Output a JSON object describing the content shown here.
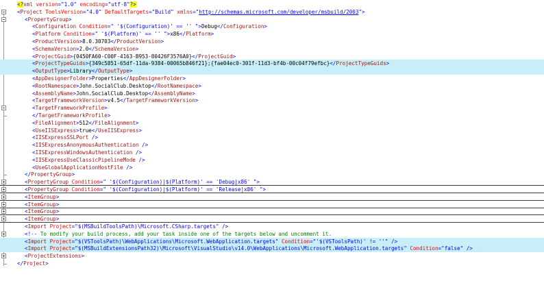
{
  "editor": {
    "lines": [
      {
        "indent": 0,
        "fold": "none",
        "parts": [
          [
            "pi",
            "<?"
          ],
          [
            "tag",
            "xml "
          ],
          [
            "attr",
            "version"
          ],
          [
            "bracket",
            "=\""
          ],
          [
            "val",
            "1.0"
          ],
          [
            "bracket",
            "\" "
          ],
          [
            "attr",
            "encoding"
          ],
          [
            "bracket",
            "=\""
          ],
          [
            "val",
            "utf-8"
          ],
          [
            "bracket",
            "\""
          ],
          [
            "pi",
            "?>"
          ]
        ]
      },
      {
        "indent": 0,
        "fold": "open",
        "parts": [
          [
            "bracket",
            "<"
          ],
          [
            "tag",
            "Project "
          ],
          [
            "attr",
            "ToolsVersion"
          ],
          [
            "bracket",
            "=\""
          ],
          [
            "val",
            "4.0"
          ],
          [
            "bracket",
            "\" "
          ],
          [
            "attr",
            "DefaultTargets"
          ],
          [
            "bracket",
            "=\""
          ],
          [
            "val",
            "Build"
          ],
          [
            "bracket",
            "\" "
          ],
          [
            "attr",
            "xmlns"
          ],
          [
            "bracket",
            "=\""
          ],
          [
            "link",
            "http://schemas.microsoft.com/developer/msbuild/2003"
          ],
          [
            "bracket",
            "\">"
          ]
        ]
      },
      {
        "indent": 1,
        "fold": "open",
        "parts": [
          [
            "bracket",
            "<"
          ],
          [
            "tag",
            "PropertyGroup"
          ],
          [
            "bracket",
            ">"
          ]
        ]
      },
      {
        "indent": 2,
        "fold": "none",
        "parts": [
          [
            "bracket",
            "<"
          ],
          [
            "tag",
            "Configuration "
          ],
          [
            "attr",
            "Condition"
          ],
          [
            "bracket",
            "=\""
          ],
          [
            "val",
            " '$(Configuration)' == '' "
          ],
          [
            "bracket",
            "\">"
          ],
          [
            "text",
            "Debug"
          ],
          [
            "bracket",
            "</"
          ],
          [
            "tag",
            "Configuration"
          ],
          [
            "bracket",
            ">"
          ]
        ]
      },
      {
        "indent": 2,
        "fold": "none",
        "parts": [
          [
            "bracket",
            "<"
          ],
          [
            "tag",
            "Platform "
          ],
          [
            "attr",
            "Condition"
          ],
          [
            "bracket",
            "=\""
          ],
          [
            "val",
            " '$(Platform)' == '' "
          ],
          [
            "bracket",
            "\">"
          ],
          [
            "text",
            "x86"
          ],
          [
            "bracket",
            "</"
          ],
          [
            "tag",
            "Platform"
          ],
          [
            "bracket",
            ">"
          ]
        ]
      },
      {
        "indent": 2,
        "fold": "none",
        "parts": [
          [
            "bracket",
            "<"
          ],
          [
            "tag",
            "ProductVersion"
          ],
          [
            "bracket",
            ">"
          ],
          [
            "text",
            "8.0.30703"
          ],
          [
            "bracket",
            "</"
          ],
          [
            "tag",
            "ProductVersion"
          ],
          [
            "bracket",
            ">"
          ]
        ]
      },
      {
        "indent": 2,
        "fold": "none",
        "parts": [
          [
            "bracket",
            "<"
          ],
          [
            "tag",
            "SchemaVersion"
          ],
          [
            "bracket",
            ">"
          ],
          [
            "text",
            "2.0"
          ],
          [
            "bracket",
            "</"
          ],
          [
            "tag",
            "SchemaVersion"
          ],
          [
            "bracket",
            ">"
          ]
        ]
      },
      {
        "indent": 2,
        "fold": "none",
        "parts": [
          [
            "bracket",
            "<"
          ],
          [
            "tag",
            "ProjectGuid"
          ],
          [
            "bracket",
            ">"
          ],
          [
            "text",
            "{0450FA60-C00F-4163-B953-80426F3576A0}"
          ],
          [
            "bracket",
            "</"
          ],
          [
            "tag",
            "ProjectGuid"
          ],
          [
            "bracket",
            ">"
          ]
        ]
      },
      {
        "indent": 2,
        "fold": "none",
        "hl": true,
        "parts": [
          [
            "bracket",
            "<"
          ],
          [
            "tag",
            "ProjectTypeGuids"
          ],
          [
            "bracket",
            ">"
          ],
          [
            "text",
            "{349c5851-65df-11da-9384-00065b846f21};{fae04ec0-301f-11d3-bf4b-00c04f79efbc}"
          ],
          [
            "bracket",
            "</"
          ],
          [
            "tag",
            "ProjectTypeGuids"
          ],
          [
            "bracket",
            ">"
          ]
        ]
      },
      {
        "indent": 2,
        "fold": "none",
        "hl": true,
        "parts": [
          [
            "bracket",
            "<"
          ],
          [
            "tag",
            "OutputType"
          ],
          [
            "bracket",
            ">"
          ],
          [
            "text",
            "Library"
          ],
          [
            "bracket",
            "</"
          ],
          [
            "tag",
            "OutputType"
          ],
          [
            "bracket",
            ">"
          ]
        ]
      },
      {
        "indent": 2,
        "fold": "none",
        "parts": [
          [
            "bracket",
            "<"
          ],
          [
            "tag",
            "AppDesignerFolder"
          ],
          [
            "bracket",
            ">"
          ],
          [
            "text",
            "Properties"
          ],
          [
            "bracket",
            "</"
          ],
          [
            "tag",
            "AppDesignerFolder"
          ],
          [
            "bracket",
            ">"
          ]
        ]
      },
      {
        "indent": 2,
        "fold": "none",
        "parts": [
          [
            "bracket",
            "<"
          ],
          [
            "tag",
            "RootNamespace"
          ],
          [
            "bracket",
            ">"
          ],
          [
            "text",
            "John.SocialClub.Desktop"
          ],
          [
            "bracket",
            "</"
          ],
          [
            "tag",
            "RootNamespace"
          ],
          [
            "bracket",
            ">"
          ]
        ]
      },
      {
        "indent": 2,
        "fold": "none",
        "parts": [
          [
            "bracket",
            "<"
          ],
          [
            "tag",
            "AssemblyName"
          ],
          [
            "bracket",
            ">"
          ],
          [
            "text",
            "John.SocialClub.Desktop"
          ],
          [
            "bracket",
            "</"
          ],
          [
            "tag",
            "AssemblyName"
          ],
          [
            "bracket",
            ">"
          ]
        ]
      },
      {
        "indent": 2,
        "fold": "none",
        "parts": [
          [
            "bracket",
            "<"
          ],
          [
            "tag",
            "TargetFrameworkVersion"
          ],
          [
            "bracket",
            ">"
          ],
          [
            "text",
            "v4.5"
          ],
          [
            "bracket",
            "</"
          ],
          [
            "tag",
            "TargetFrameworkVersion"
          ],
          [
            "bracket",
            ">"
          ]
        ]
      },
      {
        "indent": 2,
        "fold": "open",
        "parts": [
          [
            "bracket",
            "<"
          ],
          [
            "tag",
            "TargetFrameworkProfile"
          ],
          [
            "bracket",
            ">"
          ]
        ]
      },
      {
        "indent": 2,
        "fold": "end",
        "parts": [
          [
            "bracket",
            "</"
          ],
          [
            "tag",
            "TargetFrameworkProfile"
          ],
          [
            "bracket",
            ">"
          ]
        ]
      },
      {
        "indent": 2,
        "fold": "none",
        "parts": [
          [
            "bracket",
            "<"
          ],
          [
            "tag",
            "FileAlignment"
          ],
          [
            "bracket",
            ">"
          ],
          [
            "text",
            "512"
          ],
          [
            "bracket",
            "</"
          ],
          [
            "tag",
            "FileAlignment"
          ],
          [
            "bracket",
            ">"
          ]
        ]
      },
      {
        "indent": 2,
        "fold": "none",
        "parts": [
          [
            "bracket",
            "<"
          ],
          [
            "tag",
            "UseIISExpress"
          ],
          [
            "bracket",
            ">"
          ],
          [
            "text",
            "true"
          ],
          [
            "bracket",
            "</"
          ],
          [
            "tag",
            "UseIISExpress"
          ],
          [
            "bracket",
            ">"
          ]
        ]
      },
      {
        "indent": 2,
        "fold": "none",
        "parts": [
          [
            "bracket",
            "<"
          ],
          [
            "tag",
            "IISExpressSSLPort "
          ],
          [
            "bracket",
            "/>"
          ]
        ]
      },
      {
        "indent": 2,
        "fold": "none",
        "parts": [
          [
            "bracket",
            "<"
          ],
          [
            "tag",
            "IISExpressAnonymousAuthentication "
          ],
          [
            "bracket",
            "/>"
          ]
        ]
      },
      {
        "indent": 2,
        "fold": "none",
        "parts": [
          [
            "bracket",
            "<"
          ],
          [
            "tag",
            "IISExpressWindowsAuthentication "
          ],
          [
            "bracket",
            "/>"
          ]
        ]
      },
      {
        "indent": 2,
        "fold": "none",
        "parts": [
          [
            "bracket",
            "<"
          ],
          [
            "tag",
            "IISExpressUseClassicPipelineMode "
          ],
          [
            "bracket",
            "/>"
          ]
        ]
      },
      {
        "indent": 2,
        "fold": "none",
        "parts": [
          [
            "bracket",
            "<"
          ],
          [
            "tag",
            "UseGlobalApplicationHostFile "
          ],
          [
            "bracket",
            "/>"
          ]
        ]
      },
      {
        "indent": 1,
        "fold": "end",
        "parts": [
          [
            "bracket",
            "</"
          ],
          [
            "tag",
            "PropertyGroup"
          ],
          [
            "bracket",
            ">"
          ]
        ]
      },
      {
        "indent": 1,
        "fold": "closed",
        "sep": true,
        "parts": [
          [
            "bracket",
            "<"
          ],
          [
            "tag",
            "PropertyGroup "
          ],
          [
            "attr",
            "Condition"
          ],
          [
            "bracket",
            "=\""
          ],
          [
            "val",
            " '$(Configuration)|$(Platform)' == 'Debug|x86' "
          ],
          [
            "bracket",
            "\">"
          ]
        ]
      },
      {
        "indent": 1,
        "fold": "closed",
        "sep": true,
        "parts": [
          [
            "bracket",
            "<"
          ],
          [
            "tag",
            "PropertyGroup "
          ],
          [
            "attr",
            "Condition"
          ],
          [
            "bracket",
            "=\""
          ],
          [
            "val",
            " '$(Configuration)|$(Platform)' == 'Release|x86' "
          ],
          [
            "bracket",
            "\">"
          ]
        ]
      },
      {
        "indent": 1,
        "fold": "closed",
        "sep": true,
        "parts": [
          [
            "bracket",
            "<"
          ],
          [
            "tag",
            "ItemGroup"
          ],
          [
            "bracket",
            ">"
          ]
        ]
      },
      {
        "indent": 1,
        "fold": "closed",
        "sep": true,
        "parts": [
          [
            "bracket",
            "<"
          ],
          [
            "tag",
            "ItemGroup"
          ],
          [
            "bracket",
            ">"
          ]
        ]
      },
      {
        "indent": 1,
        "fold": "closed",
        "sep": true,
        "parts": [
          [
            "bracket",
            "<"
          ],
          [
            "tag",
            "ItemGroup"
          ],
          [
            "bracket",
            ">"
          ]
        ]
      },
      {
        "indent": 1,
        "fold": "closed",
        "sep": true,
        "parts": [
          [
            "bracket",
            "<"
          ],
          [
            "tag",
            "ItemGroup"
          ],
          [
            "bracket",
            ">"
          ]
        ]
      },
      {
        "indent": 1,
        "fold": "none",
        "parts": [
          [
            "bracket",
            "<"
          ],
          [
            "tag",
            "Import "
          ],
          [
            "attr",
            "Project"
          ],
          [
            "bracket",
            "=\""
          ],
          [
            "val",
            "$(MSBuildToolsPath)\\Microsoft.CSharp.targets"
          ],
          [
            "bracket",
            "\" />"
          ]
        ]
      },
      {
        "indent": 1,
        "fold": "closed",
        "parts": [
          [
            "bracket",
            "<!-- "
          ],
          [
            "comment",
            "To modify your build process, add your task inside one of the targets below and uncomment it."
          ]
        ]
      },
      {
        "indent": 1,
        "fold": "none",
        "hl": true,
        "parts": [
          [
            "bracket",
            "<"
          ],
          [
            "tag",
            "Import "
          ],
          [
            "attr",
            "Project"
          ],
          [
            "bracket",
            "=\""
          ],
          [
            "val",
            "$(VSToolsPath)\\WebApplications\\Microsoft.WebApplication.targets"
          ],
          [
            "bracket",
            "\" "
          ],
          [
            "attr",
            "Condition"
          ],
          [
            "bracket",
            "=\""
          ],
          [
            "val",
            "'$(VSToolsPath)' != ''"
          ],
          [
            "bracket",
            "\" />"
          ]
        ]
      },
      {
        "indent": 1,
        "fold": "none",
        "hl": true,
        "parts": [
          [
            "bracket",
            "<"
          ],
          [
            "tag",
            "Import "
          ],
          [
            "attr",
            "Project"
          ],
          [
            "bracket",
            "=\""
          ],
          [
            "val",
            "$(MSBuildExtensionsPath32)\\Microsoft\\VisualStudio\\v14.0\\WebApplications\\Microsoft.WebApplication.targets"
          ],
          [
            "bracket",
            "\" "
          ],
          [
            "attr",
            "Condition"
          ],
          [
            "bracket",
            "=\""
          ],
          [
            "val",
            "false"
          ],
          [
            "bracket",
            "\" />"
          ]
        ]
      },
      {
        "indent": 1,
        "fold": "closed",
        "parts": [
          [
            "bracket",
            "<"
          ],
          [
            "tag",
            "ProjectExtensions"
          ],
          [
            "bracket",
            ">"
          ]
        ]
      },
      {
        "indent": 0,
        "fold": "end",
        "parts": [
          [
            "bracket",
            "</"
          ],
          [
            "tag",
            "Project"
          ],
          [
            "bracket",
            ">"
          ]
        ]
      }
    ]
  }
}
